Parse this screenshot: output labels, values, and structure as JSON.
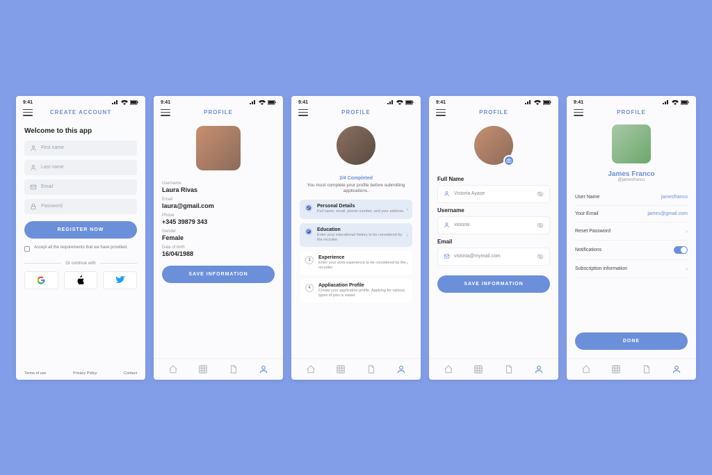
{
  "status_time": "9:41",
  "screen1": {
    "title": "CREATE ACCOUNT",
    "welcome": "Welcome to this app",
    "fields": [
      "First name",
      "Last name",
      "Email",
      "Password"
    ],
    "register_btn": "REGISTER NOW",
    "accept_text": "Accept all the requirements that we have provided.",
    "continue_text": "Or continue with",
    "footer": [
      "Terms of use",
      "Privacy Policy",
      "Contact"
    ]
  },
  "screen2": {
    "title": "PROFILE",
    "labels": [
      "Username",
      "Email",
      "Phone",
      "Gender",
      "Date of birth"
    ],
    "values": [
      "Laura Rivas",
      "laura@gmail.com",
      "+345 39879 343",
      "Female",
      "16/04/1988"
    ],
    "save_btn": "SAVE INFORMATION"
  },
  "screen3": {
    "title": "PROFILE",
    "completed": "2/4 Completed",
    "sub": "You must complete your profile before submitting applications.",
    "steps": [
      {
        "t": "Personal Details",
        "d": "Full name, email, phone number, and your address."
      },
      {
        "t": "Education",
        "d": "Enter your educational history to be considered by the recruiter"
      },
      {
        "t": "Experience",
        "d": "Enter your work experience to be considered by the recruiter"
      },
      {
        "t": "Appliacation Profile",
        "d": "Create your application profile. Applying for various types of jobs is easier."
      }
    ]
  },
  "screen4": {
    "title": "PROFILE",
    "labels": [
      "Full Name",
      "Username",
      "Email"
    ],
    "values": [
      "Vistoria Ayase",
      "vistoria",
      "vistoria@mymail.com"
    ],
    "save_btn": "SAVE INFORMATION"
  },
  "screen5": {
    "title": "PROFILE",
    "name": "James Franco",
    "handle": "@jamesfranco",
    "rows": [
      {
        "l": "User Name",
        "r": "jamesfranco"
      },
      {
        "l": "Your Email",
        "r": "james@gmail.com"
      },
      {
        "l": "Reset Password",
        "r": ""
      },
      {
        "l": "Notifications",
        "r": ""
      },
      {
        "l": "Subscription information",
        "r": ""
      }
    ],
    "done_btn": "DONE"
  }
}
